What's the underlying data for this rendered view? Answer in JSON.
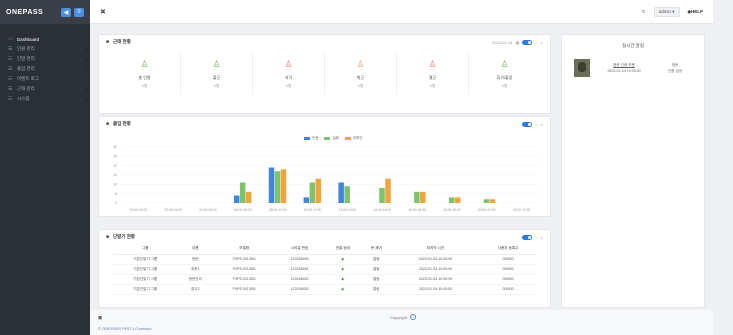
{
  "app": {
    "logo": "ONEPASS",
    "brand_btn1": "◀",
    "brand_btn2": "≡"
  },
  "sidebar": {
    "items": [
      {
        "icon": "▭",
        "label": "Dashboard",
        "chev": ""
      },
      {
        "icon": "☰",
        "label": "인원 관리",
        "chev": "›"
      },
      {
        "icon": "☷",
        "label": "단말 관리",
        "chev": "›"
      },
      {
        "icon": "☰",
        "label": "출입 관리",
        "chev": "›"
      },
      {
        "icon": "☷",
        "label": "이벤트 로그",
        "chev": "›"
      },
      {
        "icon": "☰",
        "label": "근태 관리",
        "chev": "›"
      },
      {
        "icon": "☷",
        "label": "시스템",
        "chev": "›"
      }
    ]
  },
  "topbar": {
    "close": "✖",
    "refresh": "↻",
    "user": "admin ▾",
    "help": "◆HELP"
  },
  "access_status": {
    "title": "근태 현황",
    "date": "2023-01-04",
    "cells": [
      {
        "icon": "♙",
        "color": "#7aa86b",
        "label": "총 인원",
        "value": "0명"
      },
      {
        "icon": "♙",
        "color": "#7aa86b",
        "label": "출근",
        "value": "0명"
      },
      {
        "icon": "♙",
        "color": "#e07b7b",
        "label": "지각",
        "value": "0명"
      },
      {
        "icon": "♙",
        "color": "#e8a05c",
        "label": "퇴근",
        "value": "0명"
      },
      {
        "icon": "♙",
        "color": "#e07b7b",
        "label": "결근",
        "value": "0명"
      },
      {
        "icon": "♙",
        "color": "#7aa86b",
        "label": "휴가/출장",
        "value": "0명"
      }
    ]
  },
  "chart_panel": {
    "title": "출입 현황",
    "legend": [
      "인증",
      "실패",
      "미확인"
    ]
  },
  "chart_data": {
    "type": "bar",
    "categories": [
      "00:00-02:00",
      "02:00-04:00",
      "04:00-06:00",
      "06:00-08:00",
      "08:00-10:00",
      "10:00-12:00",
      "12:00-14:00",
      "14:00-16:00",
      "16:00-18:00",
      "18:00-20:00",
      "20:00-22:00",
      "22:00-24:00"
    ],
    "series": [
      {
        "name": "인증",
        "color": "#3f86dc",
        "values": [
          0,
          0,
          0,
          4,
          19,
          3,
          11,
          0,
          0,
          0,
          0,
          0
        ]
      },
      {
        "name": "실패",
        "color": "#7cc36a",
        "values": [
          0,
          0,
          0,
          11,
          17,
          11,
          9,
          8,
          6,
          3,
          2,
          0
        ]
      },
      {
        "name": "미확인",
        "color": "#f2a33a",
        "values": [
          0,
          0,
          0,
          6,
          18,
          13,
          0,
          13,
          6,
          3,
          2,
          0
        ]
      }
    ],
    "yticks": [
      "30",
      "25",
      "20",
      "15",
      "10",
      "5",
      "0"
    ],
    "ylim": [
      0,
      30
    ]
  },
  "table_panel": {
    "title": "단말기 현황",
    "headers": [
      "그룹",
      "이름",
      "모델명",
      "시리얼 번호",
      "연결 상태",
      "문 제어",
      "마지막 시간",
      "사용자 등록수"
    ],
    "rows": [
      [
        "기본단말기 그룹",
        "정문",
        "FXPS-SG-B01",
        "123156450",
        "◉",
        "열림",
        "2023-01-04 10:00:00",
        "00/500"
      ],
      [
        "기본단말기 그룹",
        "후문1",
        "FXPS-SG-B01",
        "123156451",
        "◉",
        "열림",
        "2023-01-04 10:00:00",
        "00/500"
      ],
      [
        "기본단말기 그룹",
        "정문관리",
        "FXPS-SG-B01",
        "123156452",
        "◉",
        "열림",
        "2023-01-04 10:00:00",
        "00/500"
      ],
      [
        "기본단말기 그룹",
        "창고2",
        "FXPS-SG-B01",
        "123156453",
        "◉",
        "열림",
        "2023-01-04 10:00:00",
        "00/500"
      ]
    ]
  },
  "realtime": {
    "title": "실시간 알림",
    "name_line1": "정문 인증 허용",
    "name_line2": "2023-01-04 10:00:00",
    "right_line1": "정문",
    "right_line2": "인증 성공"
  },
  "footer": {
    "icon": "◼",
    "center": "Copyright",
    "version": "© ONEPASS PRO 1.0 version"
  }
}
